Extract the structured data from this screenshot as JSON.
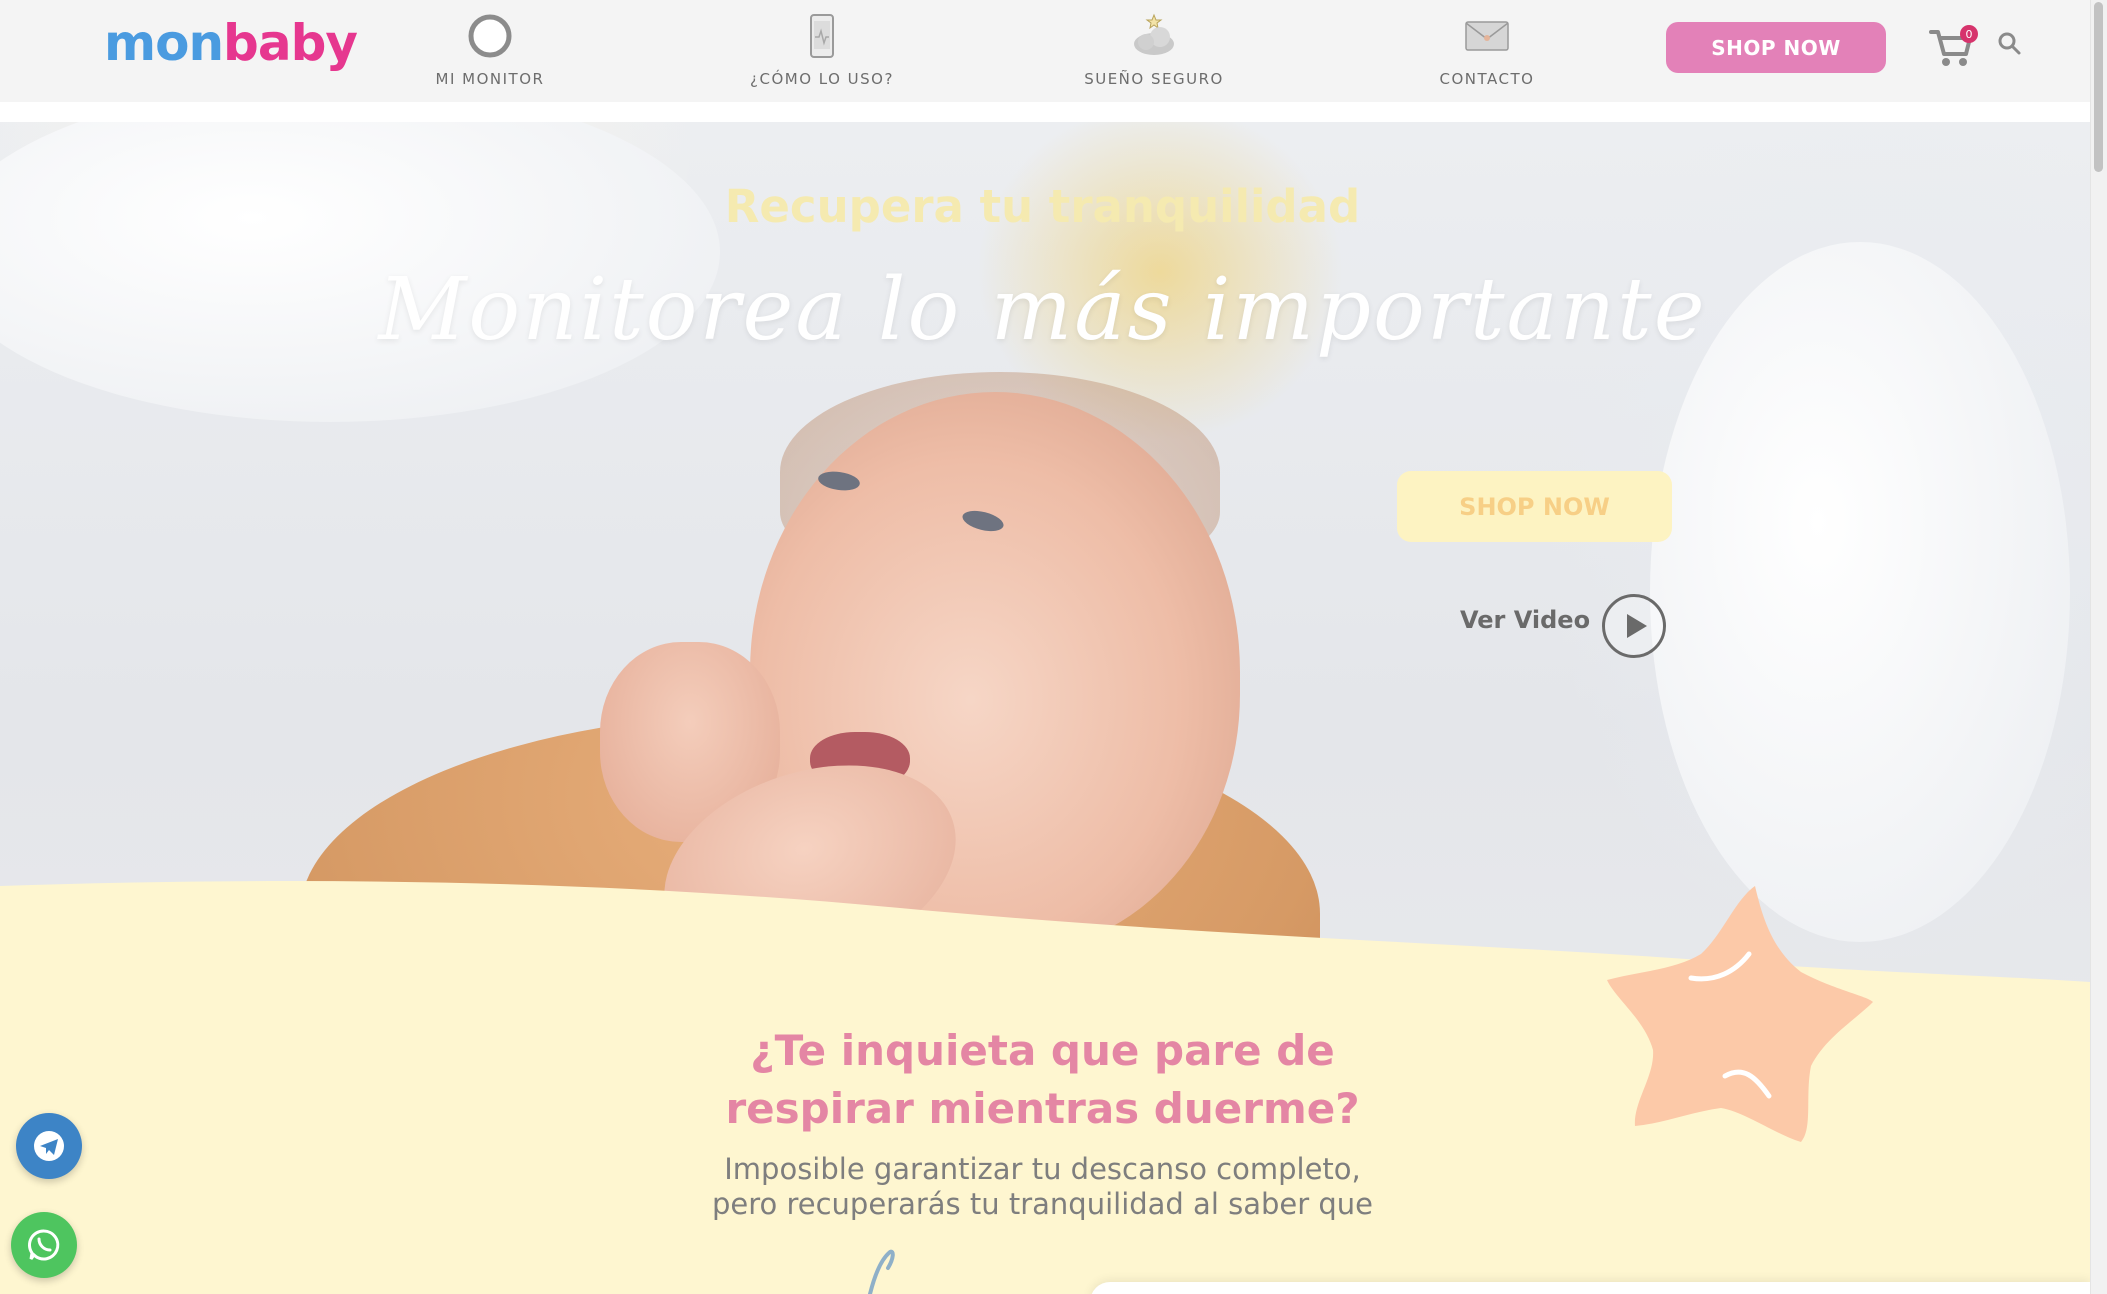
{
  "header": {
    "logo_mon": "mon",
    "logo_baby": "baby",
    "nav": [
      {
        "label": "MI MONITOR",
        "icon": "monitor-ring-icon"
      },
      {
        "label": "¿CÓMO LO USO?",
        "icon": "phone-icon"
      },
      {
        "label": "SUEÑO SEGURO",
        "icon": "sleep-cloud-icon"
      },
      {
        "label": "CONTACTO",
        "icon": "envelope-icon"
      }
    ],
    "shop_label": "SHOP NOW",
    "cart_count": "0",
    "cart_icon": "cart-icon",
    "search_icon": "search-icon"
  },
  "hero": {
    "subtitle": "Recupera tu tranquilidad",
    "script_title": "Monitorea lo más importante",
    "shop_label": "SHOP NOW",
    "video_label": "Ver Video",
    "play_icon": "play-icon"
  },
  "section": {
    "question": "¿Te inquieta que pare de respirar mientras duerme?",
    "answer_line1": "Imposible garantizar tu descanso completo,",
    "answer_line2": "pero recuperarás tu tranquilidad al saber que"
  },
  "floating": {
    "telegram_icon": "telegram-icon",
    "whatsapp_icon": "whatsapp-icon"
  },
  "colors": {
    "brand_pink": "#e381b8",
    "logo_blue": "#4a9be0",
    "logo_pink": "#e6378f",
    "cream": "#fef6d0",
    "hero_shop": "#fdf3c2",
    "question_pink": "#e486a4",
    "star_peach": "#fcc9a8",
    "telegram": "#3d84c6",
    "whatsapp": "#4ec55f"
  }
}
